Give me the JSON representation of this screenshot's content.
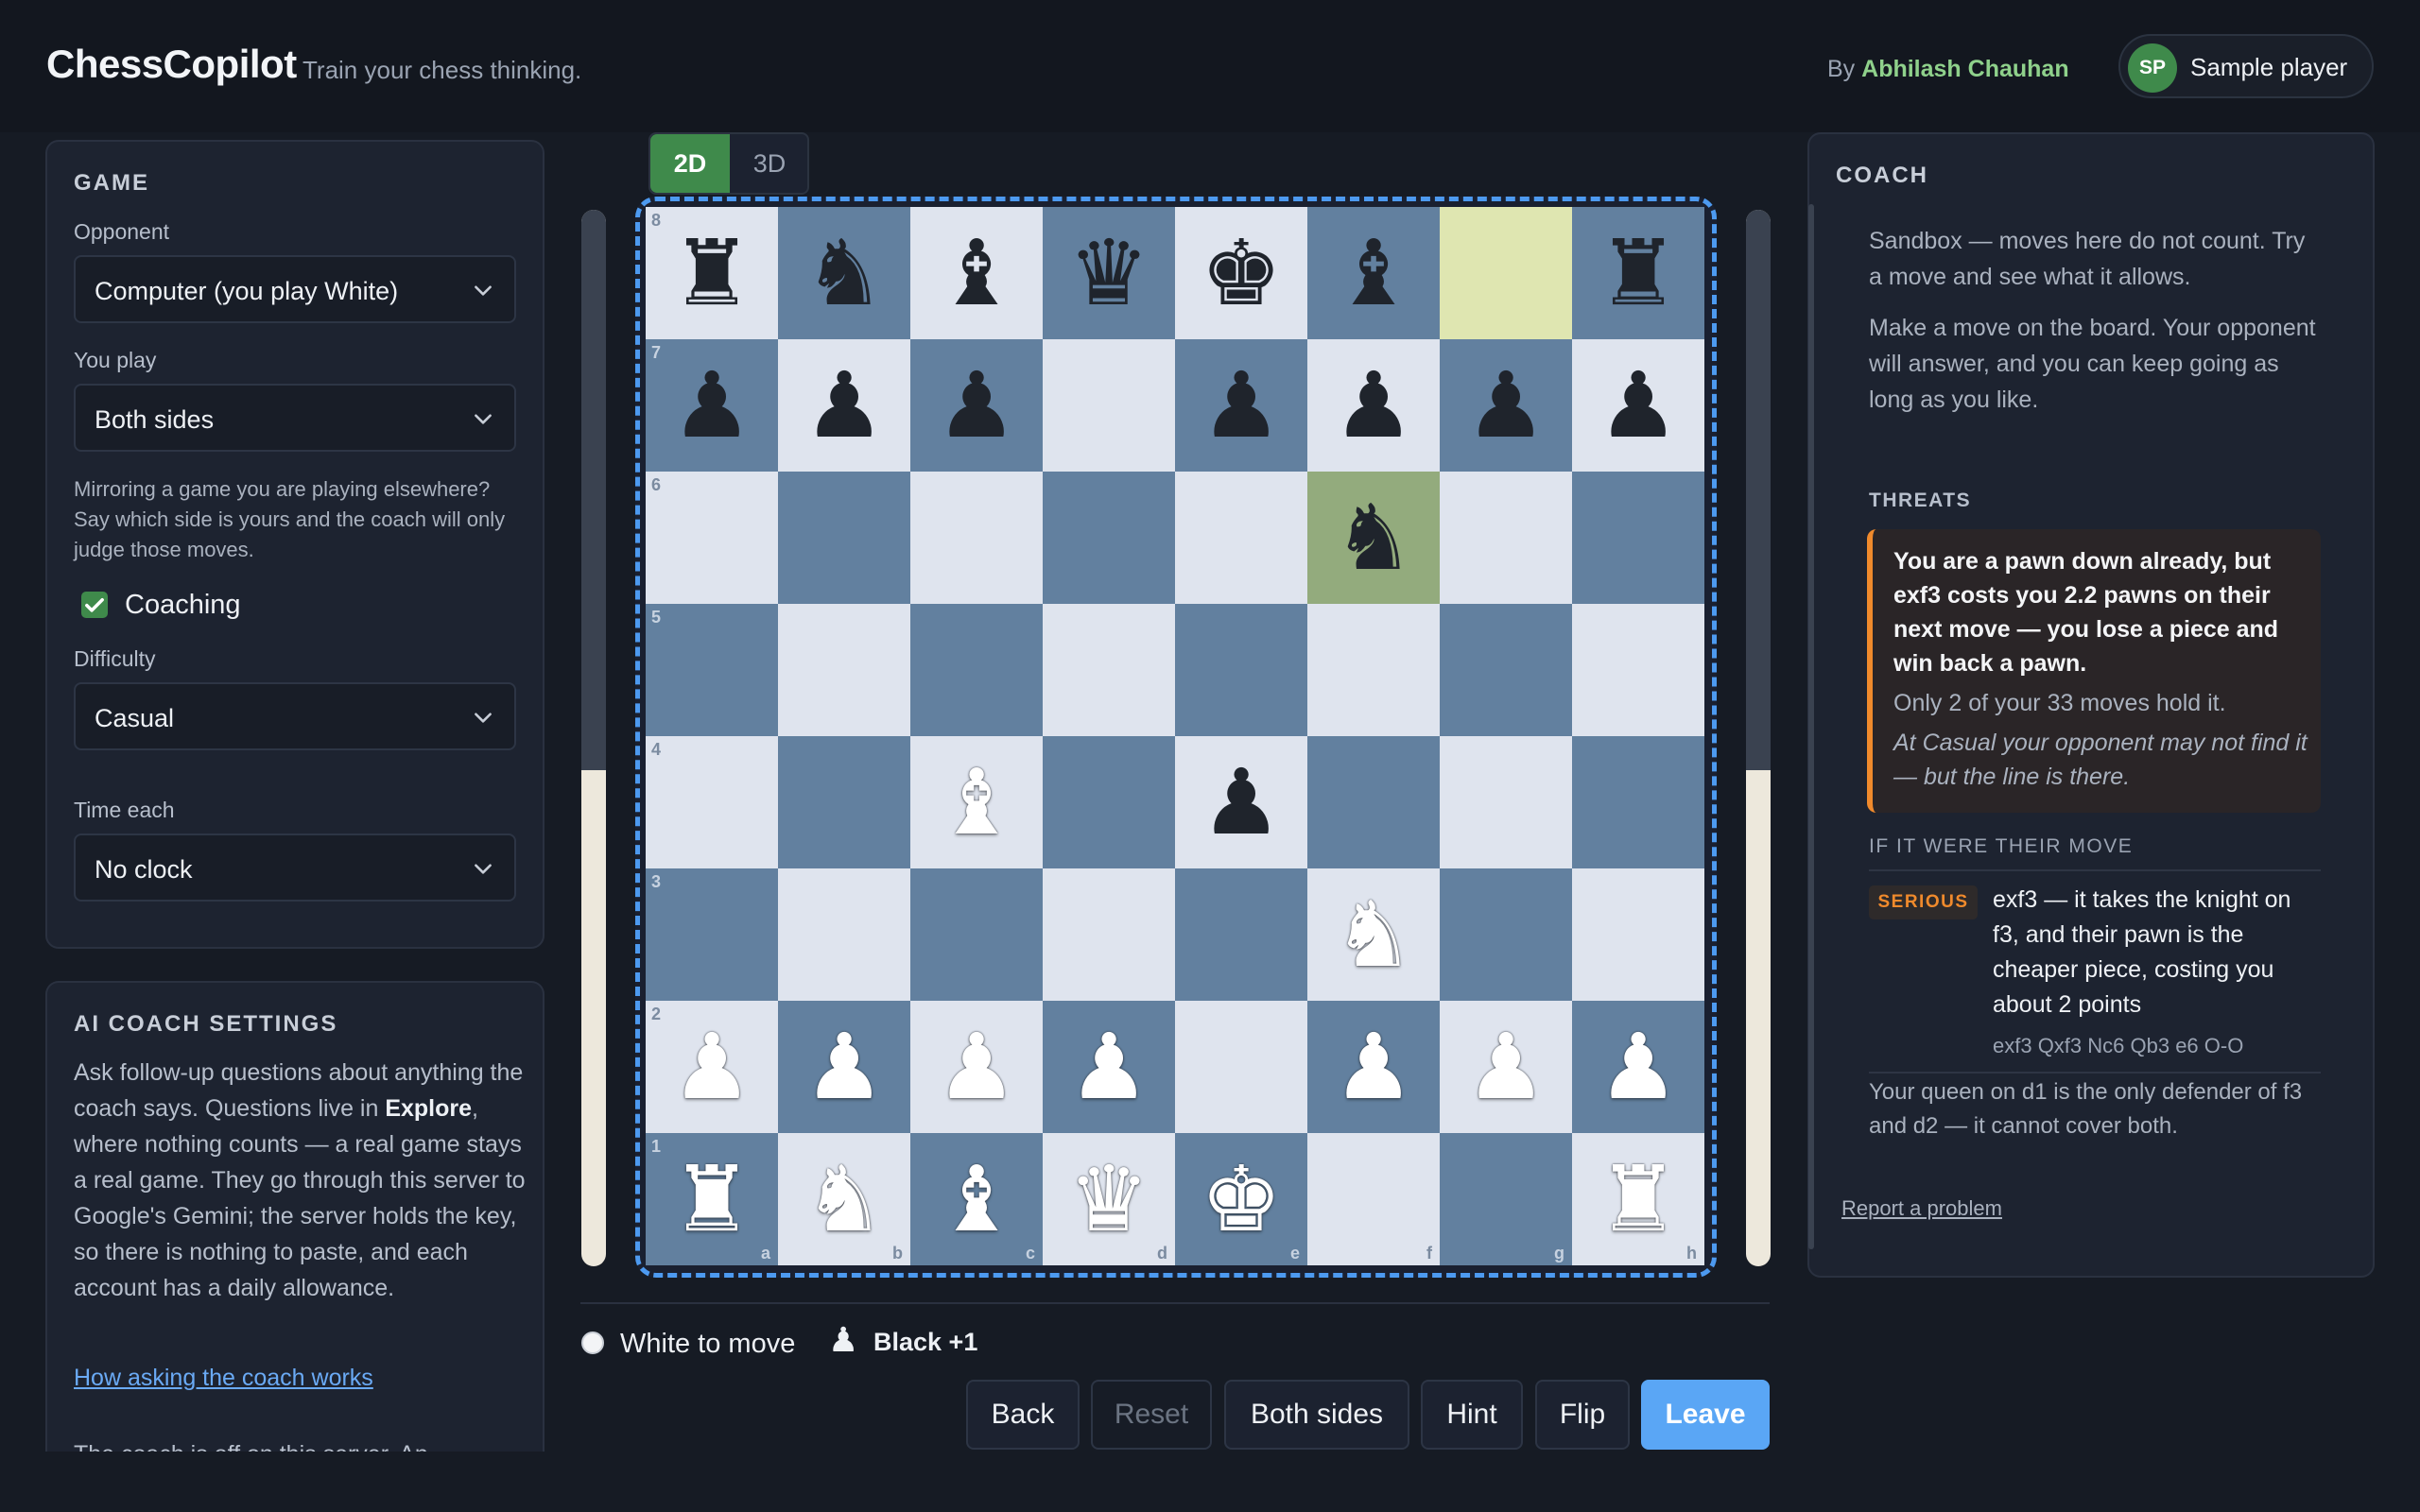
{
  "header": {
    "brand": "ChessCopilot",
    "tagline": "Train your chess thinking.",
    "by_prefix": "By",
    "author": "Abhilash Chauhan",
    "user_initials": "SP",
    "user_name": "Sample player"
  },
  "game_panel": {
    "title": "GAME",
    "opponent_label": "Opponent",
    "opponent_value": "Computer (you play White)",
    "you_play_label": "You play",
    "you_play_value": "Both sides",
    "mirror_hint": "Mirroring a game you are playing elsewhere? Say which side is yours and the coach will only judge those moves.",
    "coaching_label": "Coaching",
    "coaching_checked": true,
    "difficulty_label": "Difficulty",
    "difficulty_value": "Casual",
    "time_label": "Time each",
    "time_value": "No clock"
  },
  "ai_panel": {
    "title": "AI COACH SETTINGS",
    "text_before": "Ask follow-up questions about anything the coach says. Questions live in ",
    "text_bold": "Explore",
    "text_after": ", where nothing counts — a real game stays a real game. They go through this server to Google's Gemini; the server holds the key, so there is nothing to paste, and each account has a daily allowance.",
    "link": "How asking the coach works",
    "cut_text": "The coach is off on this server. An"
  },
  "board": {
    "view_modes": [
      "2D",
      "3D"
    ],
    "active_view": "2D",
    "ranks": [
      "8",
      "7",
      "6",
      "5",
      "4",
      "3",
      "2",
      "1"
    ],
    "files": [
      "a",
      "b",
      "c",
      "d",
      "e",
      "f",
      "g",
      "h"
    ],
    "position": [
      [
        "br",
        "bn",
        "bb",
        "bq",
        "bk",
        "bb",
        "",
        "br"
      ],
      [
        "bp",
        "bp",
        "bp",
        "",
        "bp",
        "bp",
        "bp",
        "bp"
      ],
      [
        "",
        "",
        "",
        "",
        "",
        "bn",
        "",
        ""
      ],
      [
        "",
        "",
        "",
        "",
        "",
        "",
        "",
        ""
      ],
      [
        "",
        "",
        "wb",
        "",
        "bp",
        "",
        "",
        ""
      ],
      [
        "",
        "",
        "",
        "",
        "",
        "wn",
        "",
        ""
      ],
      [
        "wp",
        "wp",
        "wp",
        "wp",
        "",
        "wp",
        "wp",
        "wp"
      ],
      [
        "wr",
        "wn",
        "wb",
        "wq",
        "wk",
        "",
        "",
        "wr"
      ]
    ],
    "last_move_from": "g8",
    "last_move_to": "f6",
    "eval_black_share": 0.53,
    "colors": {
      "light": "#dfe4ee",
      "dark": "#62809f",
      "highlight_from": "#dfe6b1",
      "highlight_to": "#93ab7d",
      "focus_border": "#4d9af0"
    }
  },
  "status": {
    "turn": "White to move",
    "material_icon": "black-pawn-icon",
    "material": "Black +1"
  },
  "controls": {
    "back": "Back",
    "reset": "Reset",
    "both_sides": "Both sides",
    "hint": "Hint",
    "flip": "Flip",
    "leave": "Leave"
  },
  "coach": {
    "title": "COACH",
    "sandbox_note": "Sandbox — moves here do not count. Try a move and see what it allows.",
    "instruction": "Make a move on the board. Your opponent will answer, and you can keep going as long as you like.",
    "threats_title": "THREATS",
    "threat_main": "You are a pawn down already, but exf3 costs you 2.2 pawns on their next move — you lose a piece and win back a pawn.",
    "threat_sub": "Only 2 of your 33 moves hold it.",
    "threat_note": "At Casual your opponent may not find it — but the line is there.",
    "if_their_move": "IF IT WERE THEIR MOVE",
    "severity": "SERIOUS",
    "serious_text": "exf3 — it takes the knight on f3, and their pawn is the cheaper piece, costing you about 2 points",
    "line": "exf3 Qxf3 Nc6 Qb3 e6 O-O",
    "defender_note": "Your queen on d1 is the only defender of f3 and d2 — it cannot cover both.",
    "report": "Report a problem"
  }
}
